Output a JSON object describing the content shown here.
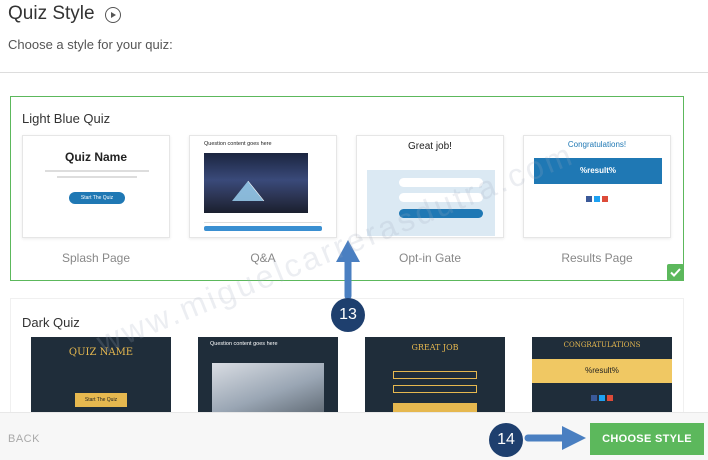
{
  "header": {
    "title": "Quiz Style",
    "subtitle": "Choose a style for your quiz:"
  },
  "groups": [
    {
      "name": "Light Blue Quiz",
      "selected": true,
      "thumbnails": [
        {
          "label": "Splash Page",
          "title": "Quiz Name",
          "button": "Start The Quiz"
        },
        {
          "label": "Q&A",
          "heading": "Question content goes here"
        },
        {
          "label": "Opt-in Gate",
          "title": "Great job!"
        },
        {
          "label": "Results Page",
          "title": "Congratulations!",
          "result": "%result%"
        }
      ]
    },
    {
      "name": "Dark Quiz",
      "thumbnails": [
        {
          "title": "QUIZ NAME",
          "button": "Start The Quiz"
        },
        {
          "heading": "Question content goes here"
        },
        {
          "title": "GREAT JOB"
        },
        {
          "title": "CONGRATULATIONS",
          "result": "%result%"
        }
      ]
    }
  ],
  "footer": {
    "back_label": "BACK",
    "choose_label": "CHOOSE STYLE"
  },
  "annotations": {
    "step_13": "13",
    "step_14": "14"
  },
  "watermark": "www.miguelcarrerasdutra.com",
  "colors": {
    "accent_green": "#5cb85c",
    "quiz_blue": "#1f78b4",
    "badge_navy": "#1e3f6e",
    "dark_quiz_bg": "#1f2d3a",
    "dark_quiz_gold": "#e6b84f",
    "arrow_blue": "#4a7fc1"
  },
  "icons": {
    "header": "play-circle-icon",
    "selected": "checkmark-icon"
  }
}
